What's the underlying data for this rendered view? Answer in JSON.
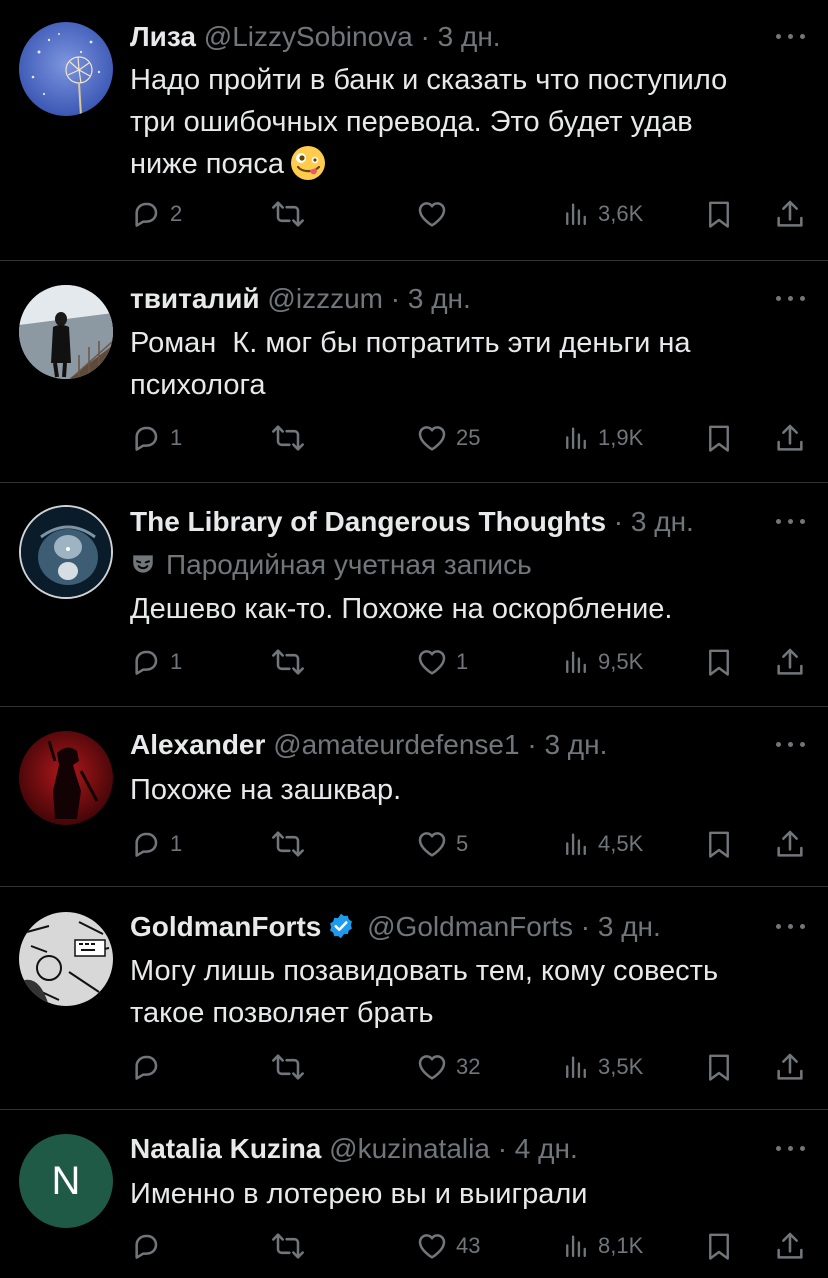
{
  "colors": {
    "background": "#000000",
    "text": "#e7e9ea",
    "muted": "#71767b",
    "divider": "#2f3336",
    "verified": "#1d9bf0",
    "natalia_avatar": "#1f5a46"
  },
  "icons": {
    "reply": "reply-icon",
    "retweet": "retweet-icon",
    "like": "heart-icon",
    "views": "views-icon",
    "bookmark": "bookmark-icon",
    "share": "share-icon",
    "more": "more-icon",
    "verified": "verified-badge-icon",
    "parody": "parody-mask-icon"
  },
  "tweets": [
    {
      "name": "Лиза",
      "handle": "@LizzySobinova",
      "dot": "·",
      "time": "3 дн.",
      "text": "Надо пройти в банк и сказать что поступило\nтри ошибочных перевода. Это будет удав\nниже пояса",
      "emoji": "zany-face-emoji",
      "replies": "2",
      "retweets": "",
      "likes": "",
      "views": "3,6K"
    },
    {
      "name": "твиталий",
      "handle": "@izzzum",
      "dot": "·",
      "time": "3 дн.",
      "text": "Роман  К. мог бы потратить эти деньги на\nпсихолога",
      "replies": "1",
      "retweets": "",
      "likes": "25",
      "views": "1,9K"
    },
    {
      "name": "The Library of Dangerous Thoughts",
      "handle": "",
      "dot": "·",
      "time": "3 дн.",
      "parody_label": "Пародийная учетная запись",
      "text": "Дешево как-то. Похоже на оскорбление.",
      "replies": "1",
      "retweets": "",
      "likes": "1",
      "views": "9,5K"
    },
    {
      "name": "Alexander",
      "handle": "@amateurdefense1",
      "dot": "·",
      "time": "3 дн.",
      "text": "Похоже на зашквар.",
      "replies": "1",
      "retweets": "",
      "likes": "5",
      "views": "4,5K"
    },
    {
      "name": "GoldmanForts",
      "handle": "@GoldmanForts",
      "dot": "·",
      "time": "3 дн.",
      "verified": true,
      "text": "Могу лишь позавидовать тем, кому совесть\nтакое позволяет брать",
      "replies": "",
      "retweets": "",
      "likes": "32",
      "views": "3,5K"
    },
    {
      "name": "Natalia Kuzina",
      "handle": "@kuzinatalia",
      "dot": "·",
      "time": "4 дн.",
      "avatar_letter": "N",
      "text": "Именно в лотерею вы и выиграли",
      "replies": "",
      "retweets": "",
      "likes": "43",
      "views": "8,1K"
    }
  ]
}
